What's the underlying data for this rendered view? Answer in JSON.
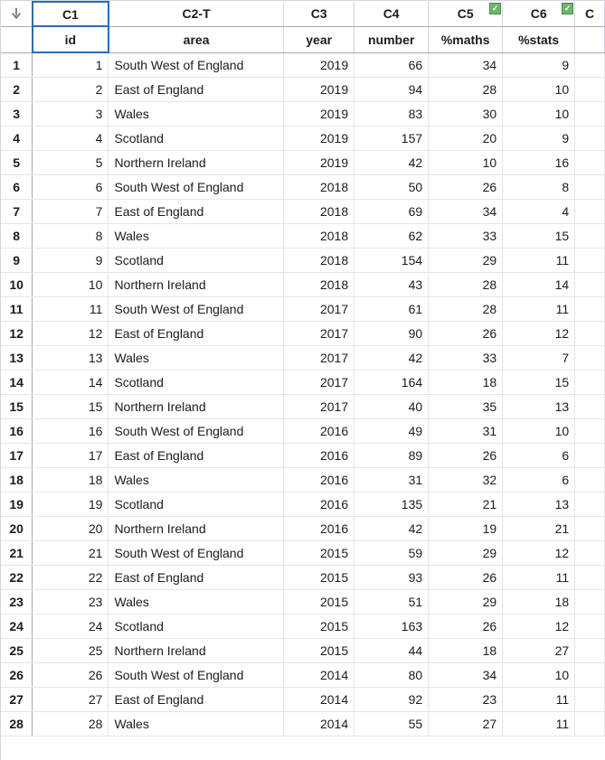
{
  "columns": {
    "corner_glyph": "↓",
    "c1": "C1",
    "c2": "C2-T",
    "c3": "C3",
    "c4": "C4",
    "c5": "C5",
    "c6": "C6",
    "c7": "C"
  },
  "fields": {
    "id": "id",
    "area": "area",
    "year": "year",
    "number": "number",
    "maths": "%maths",
    "stats": "%stats"
  },
  "selected_cell": "C1",
  "c5_checked": true,
  "c6_checked": true,
  "rows": [
    {
      "n": "1",
      "id": "1",
      "area": "South West of England",
      "year": "2019",
      "number": "66",
      "maths": "34",
      "stats": "9"
    },
    {
      "n": "2",
      "id": "2",
      "area": "East of England",
      "year": "2019",
      "number": "94",
      "maths": "28",
      "stats": "10"
    },
    {
      "n": "3",
      "id": "3",
      "area": "Wales",
      "year": "2019",
      "number": "83",
      "maths": "30",
      "stats": "10"
    },
    {
      "n": "4",
      "id": "4",
      "area": "Scotland",
      "year": "2019",
      "number": "157",
      "maths": "20",
      "stats": "9"
    },
    {
      "n": "5",
      "id": "5",
      "area": "Northern Ireland",
      "year": "2019",
      "number": "42",
      "maths": "10",
      "stats": "16"
    },
    {
      "n": "6",
      "id": "6",
      "area": "South West of England",
      "year": "2018",
      "number": "50",
      "maths": "26",
      "stats": "8"
    },
    {
      "n": "7",
      "id": "7",
      "area": "East of England",
      "year": "2018",
      "number": "69",
      "maths": "34",
      "stats": "4"
    },
    {
      "n": "8",
      "id": "8",
      "area": "Wales",
      "year": "2018",
      "number": "62",
      "maths": "33",
      "stats": "15"
    },
    {
      "n": "9",
      "id": "9",
      "area": "Scotland",
      "year": "2018",
      "number": "154",
      "maths": "29",
      "stats": "11"
    },
    {
      "n": "10",
      "id": "10",
      "area": "Northern Ireland",
      "year": "2018",
      "number": "43",
      "maths": "28",
      "stats": "14"
    },
    {
      "n": "11",
      "id": "11",
      "area": "South West of England",
      "year": "2017",
      "number": "61",
      "maths": "28",
      "stats": "11"
    },
    {
      "n": "12",
      "id": "12",
      "area": "East of England",
      "year": "2017",
      "number": "90",
      "maths": "26",
      "stats": "12"
    },
    {
      "n": "13",
      "id": "13",
      "area": "Wales",
      "year": "2017",
      "number": "42",
      "maths": "33",
      "stats": "7"
    },
    {
      "n": "14",
      "id": "14",
      "area": "Scotland",
      "year": "2017",
      "number": "164",
      "maths": "18",
      "stats": "15"
    },
    {
      "n": "15",
      "id": "15",
      "area": "Northern Ireland",
      "year": "2017",
      "number": "40",
      "maths": "35",
      "stats": "13"
    },
    {
      "n": "16",
      "id": "16",
      "area": "South West of England",
      "year": "2016",
      "number": "49",
      "maths": "31",
      "stats": "10"
    },
    {
      "n": "17",
      "id": "17",
      "area": "East of England",
      "year": "2016",
      "number": "89",
      "maths": "26",
      "stats": "6"
    },
    {
      "n": "18",
      "id": "18",
      "area": "Wales",
      "year": "2016",
      "number": "31",
      "maths": "32",
      "stats": "6"
    },
    {
      "n": "19",
      "id": "19",
      "area": "Scotland",
      "year": "2016",
      "number": "135",
      "maths": "21",
      "stats": "13"
    },
    {
      "n": "20",
      "id": "20",
      "area": "Northern Ireland",
      "year": "2016",
      "number": "42",
      "maths": "19",
      "stats": "21"
    },
    {
      "n": "21",
      "id": "21",
      "area": "South West of England",
      "year": "2015",
      "number": "59",
      "maths": "29",
      "stats": "12"
    },
    {
      "n": "22",
      "id": "22",
      "area": "East of England",
      "year": "2015",
      "number": "93",
      "maths": "26",
      "stats": "11"
    },
    {
      "n": "23",
      "id": "23",
      "area": "Wales",
      "year": "2015",
      "number": "51",
      "maths": "29",
      "stats": "18"
    },
    {
      "n": "24",
      "id": "24",
      "area": "Scotland",
      "year": "2015",
      "number": "163",
      "maths": "26",
      "stats": "12"
    },
    {
      "n": "25",
      "id": "25",
      "area": "Northern Ireland",
      "year": "2015",
      "number": "44",
      "maths": "18",
      "stats": "27"
    },
    {
      "n": "26",
      "id": "26",
      "area": "South West of England",
      "year": "2014",
      "number": "80",
      "maths": "34",
      "stats": "10"
    },
    {
      "n": "27",
      "id": "27",
      "area": "East of England",
      "year": "2014",
      "number": "92",
      "maths": "23",
      "stats": "11"
    },
    {
      "n": "28",
      "id": "28",
      "area": "Wales",
      "year": "2014",
      "number": "55",
      "maths": "27",
      "stats": "11"
    }
  ]
}
